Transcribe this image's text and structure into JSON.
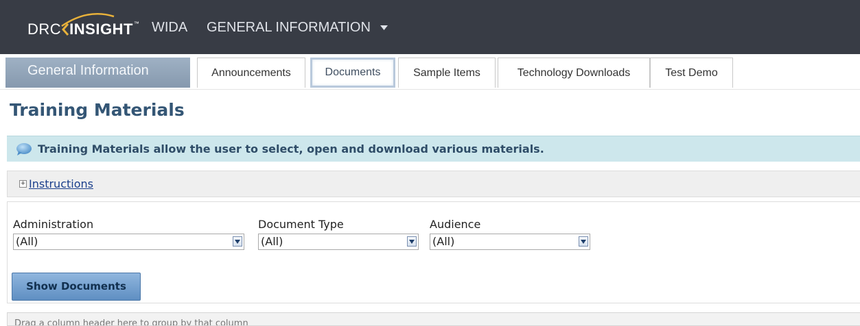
{
  "header": {
    "logo_drc": "DRC",
    "logo_insight": "INSIGHT",
    "logo_tm": "™",
    "product": "WIDA",
    "menu_label": "GENERAL INFORMATION"
  },
  "tabs": {
    "section_label": "General Information",
    "items": [
      {
        "label": "Announcements"
      },
      {
        "label": "Documents",
        "active": true
      },
      {
        "label": "Sample Items"
      },
      {
        "label": "Technology Downloads"
      },
      {
        "label": "Test Demo"
      }
    ]
  },
  "page": {
    "title": "Training Materials",
    "info_text": "Training Materials allow the user to select, open and download various materials.",
    "instructions_link": "Instructions"
  },
  "filters": {
    "administration": {
      "label": "Administration",
      "value": "(All)"
    },
    "document_type": {
      "label": "Document Type",
      "value": "(All)"
    },
    "audience": {
      "label": "Audience",
      "value": "(All)"
    },
    "show_button": "Show Documents"
  },
  "grid": {
    "group_hint": "Drag a column header here to group by that column"
  },
  "colors": {
    "topbar": "#383c45",
    "title": "#345675",
    "banner": "#cde7ec",
    "button": "#6f9bcc",
    "logo_arc": "#e8b13a"
  }
}
